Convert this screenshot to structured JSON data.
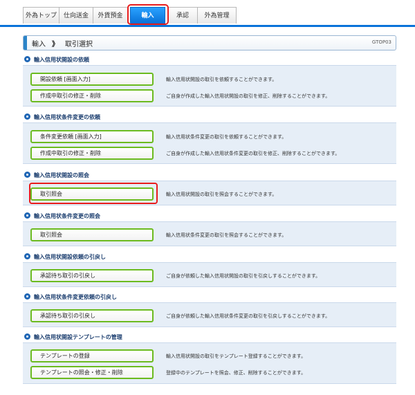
{
  "tabs": [
    {
      "label": "外為トップ"
    },
    {
      "label": "仕向送金"
    },
    {
      "label": "外貨預金"
    },
    {
      "label": "輸入"
    },
    {
      "label": "承認"
    },
    {
      "label": "外為管理"
    }
  ],
  "header": {
    "title_main": "輸入",
    "title_sep": "》",
    "title_sub": "取引選択",
    "code": "GTOP03"
  },
  "sections": [
    {
      "title": "輸入信用状開設の依頼",
      "items": [
        {
          "button": "開設依頼 [画面入力]",
          "desc": "輸入信用状開設の取引を依頼することができます。"
        },
        {
          "button": "作成中取引の修正・削除",
          "desc": "ご自身が作成した輸入信用状開設の取引を修正、削除することができます。"
        }
      ]
    },
    {
      "title": "輸入信用状条件変更の依頼",
      "items": [
        {
          "button": "条件変更依頼 [画面入力]",
          "desc": "輸入信用状条件変更の取引を依頼することができます。"
        },
        {
          "button": "作成中取引の修正・削除",
          "desc": "ご自身が作成した輸入信用状条件変更の取引を修正、削除することができます。"
        }
      ]
    },
    {
      "title": "輸入信用状開設の照会",
      "items": [
        {
          "button": "取引照会",
          "desc": "輸入信用状開設の取引を照会することができます。"
        }
      ]
    },
    {
      "title": "輸入信用状条件変更の照会",
      "items": [
        {
          "button": "取引照会",
          "desc": "輸入信用状条件変更の取引を照会することができます。"
        }
      ]
    },
    {
      "title": "輸入信用状開設依頼の引戻し",
      "items": [
        {
          "button": "承認待ち取引の引戻し",
          "desc": "ご自身が依頼した輸入信用状開設の取引を引戻しすることができます。"
        }
      ]
    },
    {
      "title": "輸入信用状条件変更依頼の引戻し",
      "items": [
        {
          "button": "承認待ち取引の引戻し",
          "desc": "ご自身が依頼した輸入信用状条件変更の取引を引戻しすることができます。"
        }
      ]
    },
    {
      "title": "輸入信用状開設テンプレートの管理",
      "items": [
        {
          "button": "テンプレートの登録",
          "desc": "輸入信用状開設の取引をテンプレート登録することができます。"
        },
        {
          "button": "テンプレートの照会・修正・削除",
          "desc": "登録中のテンプレートを照会、修正、削除することができます。"
        }
      ]
    }
  ],
  "colors": {
    "accent": "#0a73d9",
    "button_border": "#6bbb1f",
    "highlight": "#e81c1c",
    "panel_bg": "#e6eef7"
  }
}
